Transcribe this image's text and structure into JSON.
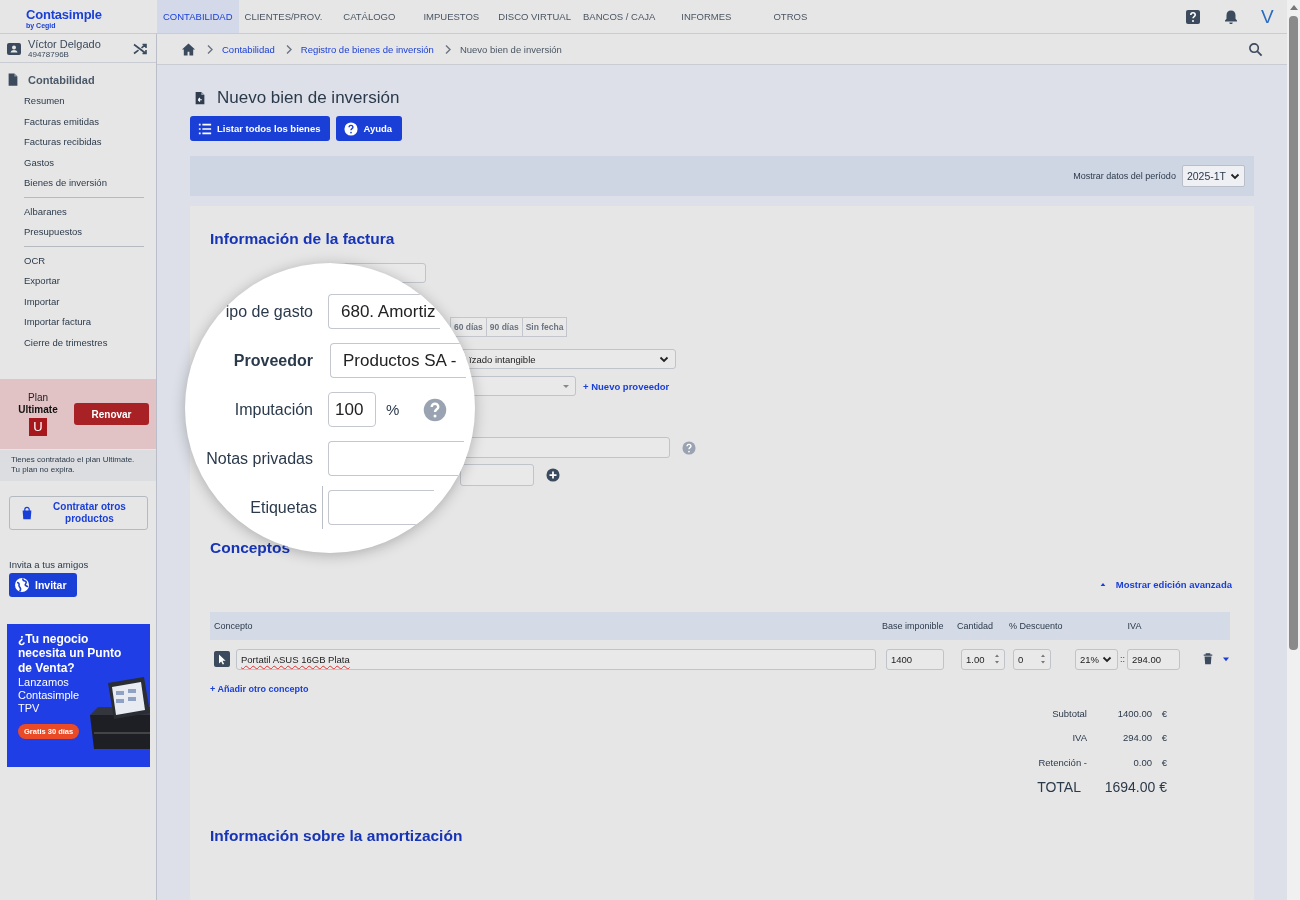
{
  "app": {
    "logo": "Contasimple",
    "logo_sub": "by Cegid",
    "avatar": "V"
  },
  "nav": [
    {
      "label": "CONTABILIDAD",
      "selected": true
    },
    {
      "label": "CLIENTES/PROV.",
      "selected": false
    },
    {
      "label": "CATÁLOGO",
      "selected": false
    },
    {
      "label": "IMPUESTOS",
      "selected": false
    },
    {
      "label": "DISCO VIRTUAL",
      "selected": false
    },
    {
      "label": "BANCOS / CAJA",
      "selected": false
    },
    {
      "label": "INFORMES",
      "selected": false
    },
    {
      "label": "OTROS",
      "selected": false
    }
  ],
  "user": {
    "name": "Víctor Delgado",
    "id": "49478796B"
  },
  "sidebar": {
    "section": "Contabilidad",
    "groups": [
      [
        "Resumen",
        "Facturas emitidas",
        "Facturas recibidas",
        "Gastos",
        "Bienes de inversión"
      ],
      [
        "Albaranes",
        "Presupuestos"
      ],
      [
        "OCR",
        "Exportar",
        "Importar",
        "Importar factura",
        "Cierre de trimestres"
      ]
    ]
  },
  "plan": {
    "label": "Plan",
    "name": "Ultimate",
    "badge": "U",
    "button": "Renovar",
    "note_lines": [
      "Tienes contratado el plan Ultimate.",
      "Tu plan no expira."
    ]
  },
  "other_products": "Contratar otros productos",
  "invite": {
    "label": "Invita a tus amigos",
    "button": "Invitar"
  },
  "ad": {
    "headline": "¿Tu negocio necesita un Punto de Venta?",
    "text": "Lanzamos Contasimple TPV",
    "badge": "Gratis 30 días"
  },
  "breadcrumb": [
    {
      "label": "Contabilidad",
      "kind": "link"
    },
    {
      "label": "Registro de bienes de inversión",
      "kind": "link"
    },
    {
      "label": "Nuevo bien de inversión",
      "kind": "current"
    }
  ],
  "page": {
    "title": "Nuevo bien de inversión",
    "buttons": [
      {
        "label": "Listar todos los bienes"
      },
      {
        "label": "Ayuda"
      }
    ]
  },
  "period": {
    "label": "Mostrar datos del período",
    "value": "2025-1T"
  },
  "invoice": {
    "heading": "Información de la factura",
    "due_buttons": [
      "60 días",
      "90 días",
      "Sin fecha"
    ],
    "expense_type": "ïzado intangible",
    "new_supplier": "+ Nuevo proveedor"
  },
  "magnifier": {
    "fields": [
      {
        "kind": "input",
        "label": "ipo de gasto",
        "bold": false,
        "value": "680. Amortiz"
      },
      {
        "kind": "select",
        "label": "Proveedor",
        "bold": true,
        "value": "Productos SA -"
      },
      {
        "kind": "percent",
        "label": "Imputación",
        "bold": false,
        "value": "100",
        "unit": "%"
      },
      {
        "kind": "input",
        "label": "Notas privadas",
        "bold": false
      },
      {
        "kind": "tags",
        "label": "Etiquetas",
        "bold": false
      }
    ]
  },
  "concepts": {
    "heading": "Conceptos",
    "advanced_link": "Mostrar edición avanzada",
    "columns": [
      "Concepto",
      "Base imponible",
      "Cantidad",
      "% Descuento",
      "IVA"
    ],
    "rows": [
      {
        "concept": "Portatil ASUS 16GB Plata",
        "base": "1400",
        "quantity": "1.00",
        "discount": "0",
        "vat_rate": "21%",
        "separator": "::",
        "vat_amount": "294.00"
      }
    ],
    "add_link": "+ Añadir otro concepto",
    "totals": [
      {
        "kind": "normal",
        "label": "Subtotal",
        "value": "1400.00",
        "currency": "€"
      },
      {
        "kind": "normal",
        "label": "IVA",
        "value": "294.00",
        "currency": "€"
      },
      {
        "kind": "normal",
        "label": "Retención -",
        "value": "0.00",
        "currency": "€"
      },
      {
        "kind": "grand",
        "label": "TOTAL",
        "value": "1694.00 €"
      }
    ]
  },
  "amortization": {
    "heading": "Información sobre la amortización"
  }
}
